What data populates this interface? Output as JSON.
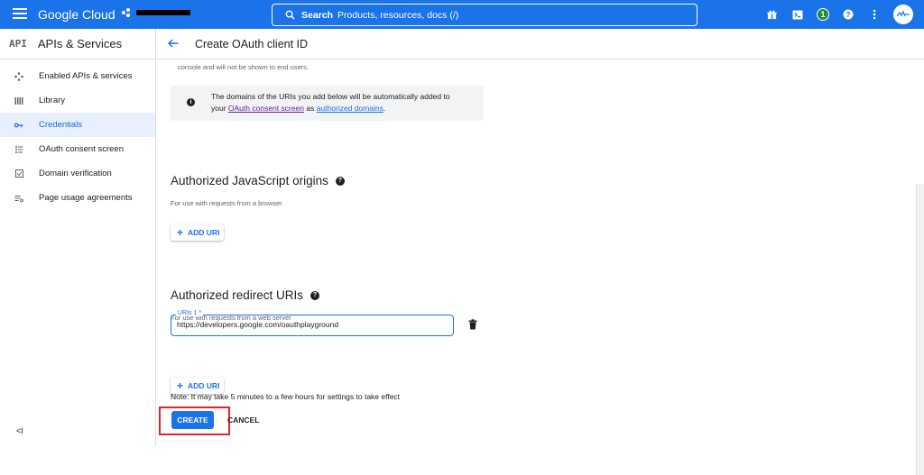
{
  "topbar": {
    "brand": "Google Cloud",
    "search_label": "Search",
    "search_placeholder": "Products, resources, docs (/)",
    "notification_count": "1",
    "colors": {
      "bar": "#1a73e8",
      "badge": "#1e8e3e"
    },
    "icons": [
      "gift-icon",
      "terminal-icon",
      "help-icon",
      "more-vert-icon",
      "avatar"
    ]
  },
  "sidebar": {
    "logo": "API",
    "title": "APIs & Services",
    "items": [
      {
        "label": "Enabled APIs & services",
        "icon": "dashboard-icon"
      },
      {
        "label": "Library",
        "icon": "library-icon"
      },
      {
        "label": "Credentials",
        "icon": "key-icon",
        "active": true
      },
      {
        "label": "OAuth consent screen",
        "icon": "consent-icon"
      },
      {
        "label": "Domain verification",
        "icon": "checkbox-icon"
      },
      {
        "label": "Page usage agreements",
        "icon": "settings-list-icon"
      }
    ],
    "collapse": "<I"
  },
  "page": {
    "title": "Create OAuth client ID",
    "faded_text": "console and will not be shown to end users.",
    "info": {
      "part1": "The domains of the URIs you add below will be automatically added to",
      "part2": "your ",
      "link1": "OAuth consent screen",
      "part3": " as ",
      "link2": "authorized domains",
      "part4": "."
    },
    "js_origins": {
      "title": "Authorized JavaScript origins",
      "subtitle": "For use with requests from a browser",
      "add_label": "ADD URI"
    },
    "redirect_uris": {
      "title": "Authorized redirect URIs",
      "subtitle": "For use with requests from a web server",
      "field_label": "URIs 1 *",
      "field_value": "https://developers.google.com/oauthplayground",
      "add_label": "ADD URI"
    },
    "note": "Note: It may take 5 minutes to a few hours for settings to take effect",
    "create_label": "CREATE",
    "cancel_label": "CANCEL",
    "highlight_color": "#e3242b"
  }
}
